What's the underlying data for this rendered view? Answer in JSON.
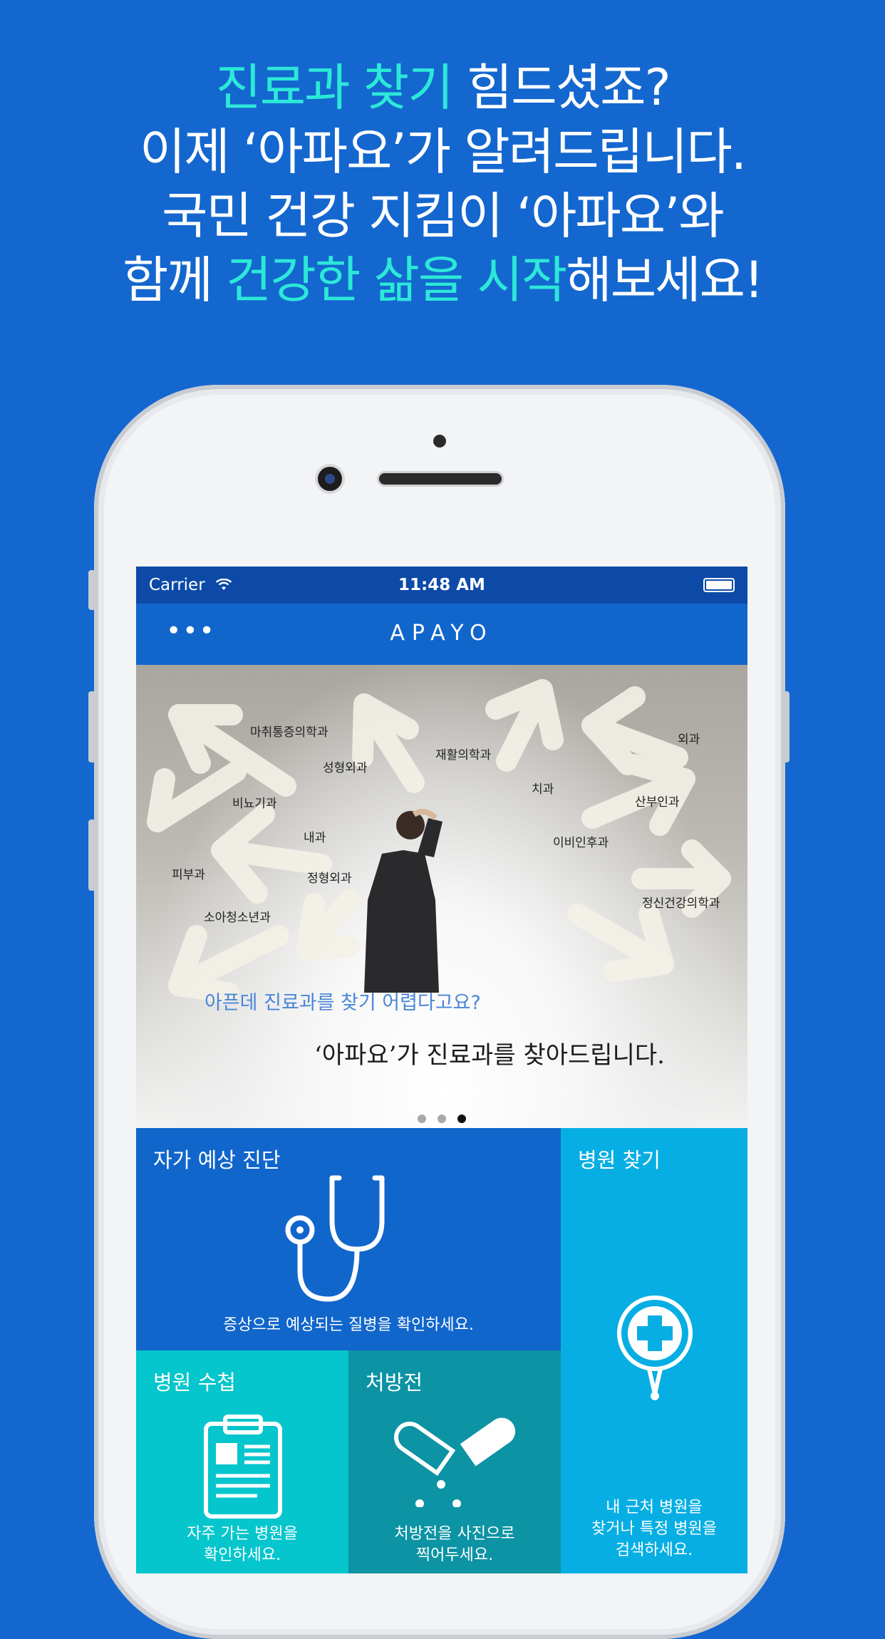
{
  "headline": {
    "line1_highlight": "진료과 찾기",
    "line1_rest": " 힘드셨죠?",
    "line2": "이제 ‘아파요’가 알려드립니다.",
    "line3": "국민 건강 지킴이 ‘아파요’와",
    "line4_pre": "함께 ",
    "line4_highlight": "건강한 삶을 시작",
    "line4_post": "해보세요!"
  },
  "status_bar": {
    "carrier": "Carrier",
    "time": "11:48 AM"
  },
  "nav": {
    "more": "•••",
    "title": "APAYO"
  },
  "banner": {
    "subtitle": "아픈데 진료과를 찾기 어렵다고요?",
    "headline": "‘아파요’가 진료과를 찾아드립니다.",
    "wall_labels": [
      "마취통증의학과",
      "성형외과",
      "재활의학과",
      "외과",
      "비뇨기과",
      "치과",
      "산부인과",
      "내과",
      "이비인후과",
      "피부과",
      "정형외과",
      "정신건강의학과",
      "소아청소년과"
    ],
    "carousel": {
      "count": 3,
      "active_index": 2
    }
  },
  "tiles": [
    {
      "id": "self-diagnosis",
      "title": "자가 예상 진단",
      "desc": "증상으로 예상되는 질병을 확인하세요.",
      "icon": "stethoscope-icon",
      "color": "#1166cc"
    },
    {
      "id": "hospital-search",
      "title": "병원 찾기",
      "desc": [
        "내 근처 병원을",
        "찾거나 특정 병원을",
        "검색하세요."
      ],
      "icon": "hospital-pin-icon",
      "color": "#06aee3"
    },
    {
      "id": "hospital-notebook",
      "title": "병원 수첩",
      "desc": [
        "자주 가는 병원을",
        "확인하세요."
      ],
      "icon": "clipboard-icon",
      "color": "#04c6cc"
    },
    {
      "id": "prescription",
      "title": "처방전",
      "desc": [
        "처방전을 사진으로",
        "찍어두세요."
      ],
      "icon": "pill-icon",
      "color": "#0c93a4"
    }
  ],
  "colors": {
    "background": "#1467cf",
    "highlight": "#2ce8d8",
    "nav": "#1166cc",
    "status": "#0d4aa8"
  }
}
